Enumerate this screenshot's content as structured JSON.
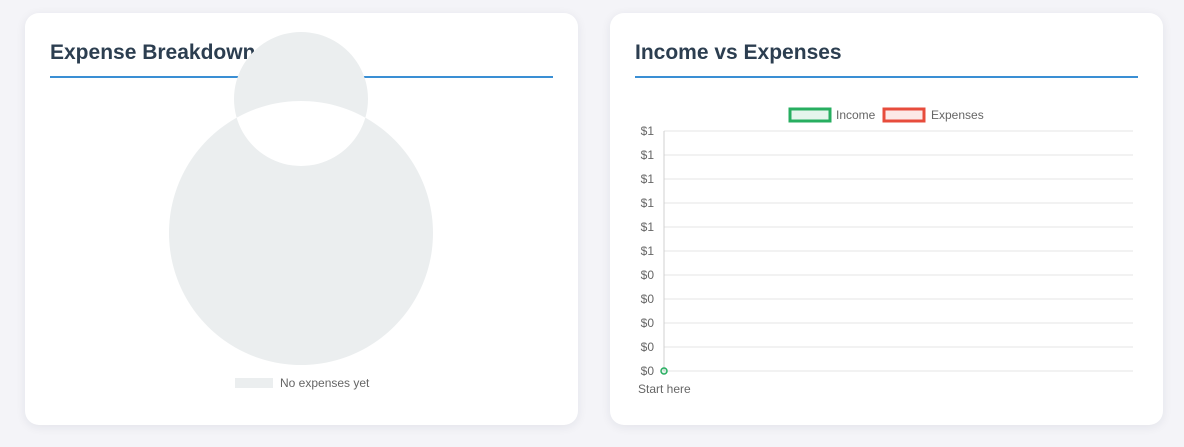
{
  "colors": {
    "title": "#2c3e50",
    "title_underline": "#3a8fd4",
    "empty_slice": "#ebeeef",
    "income": "#27ae60",
    "expenses": "#e74c3c",
    "grid": "#e5e5e5",
    "text": "#666666"
  },
  "chart_data": [
    {
      "type": "pie",
      "title": "Expense Breakdown",
      "donut": true,
      "categories": [
        "No expenses yet"
      ],
      "values": [
        1
      ],
      "legend": "bottom"
    },
    {
      "type": "line",
      "title": "Income vs Expenses",
      "categories": [
        "Start here"
      ],
      "series": [
        {
          "name": "Income",
          "values": [
            0
          ]
        },
        {
          "name": "Expenses",
          "values": []
        }
      ],
      "ytick_labels": [
        "$0",
        "$0",
        "$0",
        "$0",
        "$0",
        "$1",
        "$1",
        "$1",
        "$1",
        "$1",
        "$1"
      ],
      "ylim": [
        0,
        1
      ],
      "grid": true,
      "legend": "top"
    }
  ]
}
